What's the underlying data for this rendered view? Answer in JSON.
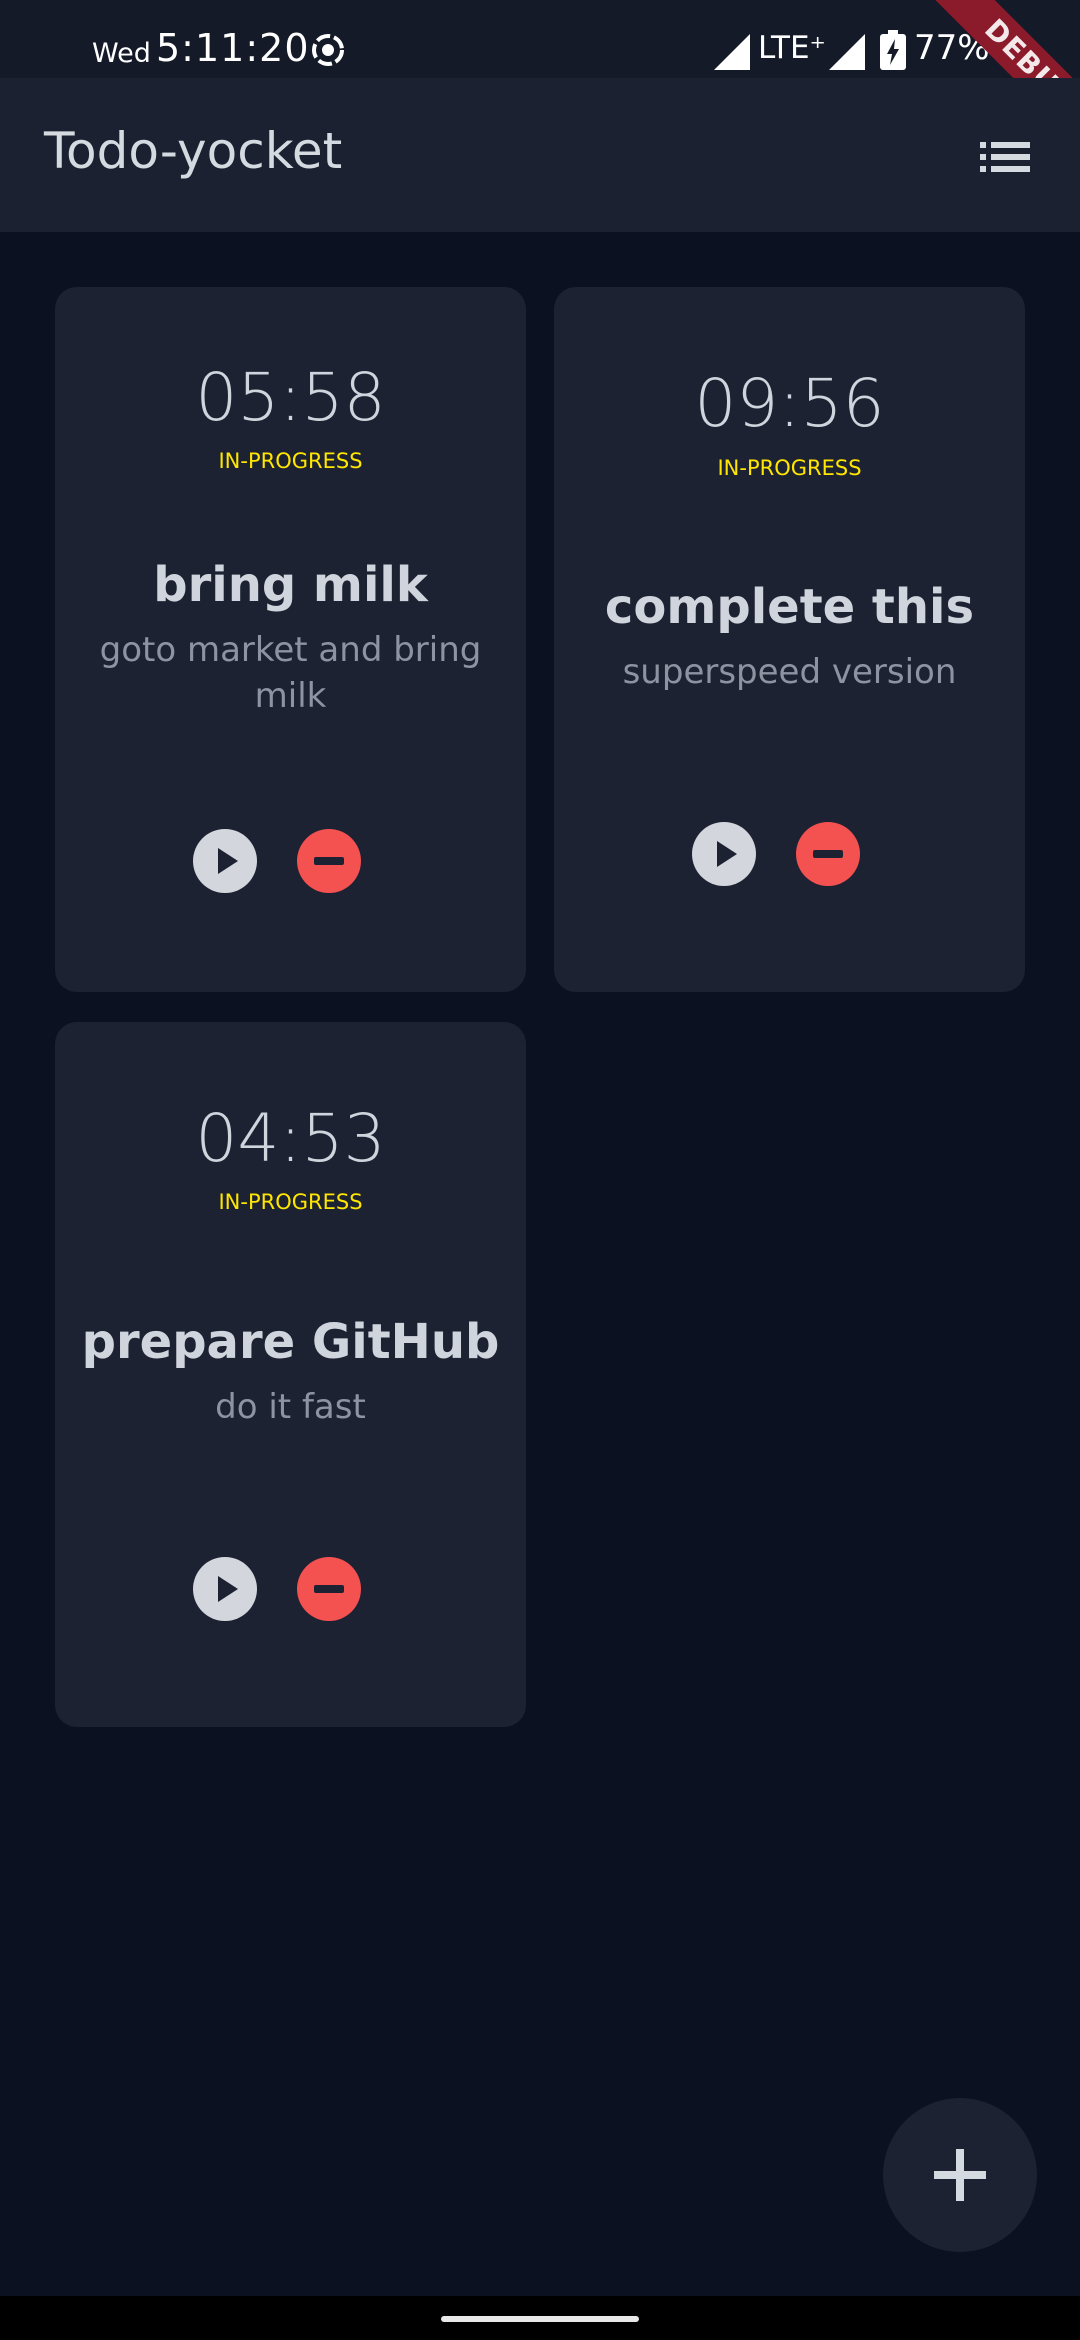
{
  "status_bar": {
    "day": "Wed",
    "time": "5:11:20",
    "network": "LTE⁺",
    "battery": "77%"
  },
  "debug_banner": "DEBUG",
  "app_bar": {
    "title": "Todo-yocket",
    "menu_icon": "list-icon"
  },
  "todos": [
    {
      "time": "05:58",
      "status": "IN-PROGRESS",
      "title": "bring milk",
      "description": "goto market and bring milk"
    },
    {
      "time": "09:56",
      "status": "IN-PROGRESS",
      "title": "complete this",
      "description": "superspeed version"
    },
    {
      "time": "04:53",
      "status": "IN-PROGRESS",
      "title": "prepare GitHub",
      "description": "do it fast"
    }
  ],
  "fab_icon": "plus-icon",
  "colors": {
    "background": "#0b1120",
    "card": "#1d2232",
    "status_yellow": "#ffe600",
    "remove_red": "#f45151"
  }
}
